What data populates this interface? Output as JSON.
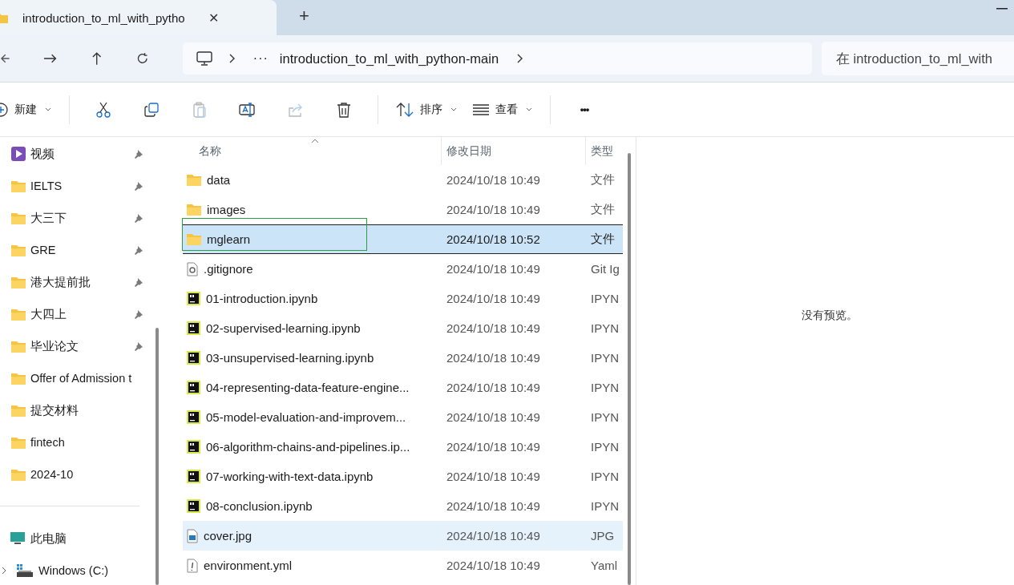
{
  "tab": {
    "title": "introduction_to_ml_with_pytho",
    "close": "✕",
    "new": "+"
  },
  "address": {
    "ellipsis": "···",
    "path": "introduction_to_ml_with_python-main"
  },
  "search": {
    "placeholder": "在 introduction_to_ml_with"
  },
  "toolbar": [
    {
      "kind": "new",
      "label": "新建",
      "disabled": false
    },
    {
      "kind": "cut",
      "disabled": false
    },
    {
      "kind": "copy",
      "disabled": false
    },
    {
      "kind": "paste",
      "disabled": true
    },
    {
      "kind": "rename",
      "disabled": false
    },
    {
      "kind": "share",
      "disabled": true
    },
    {
      "kind": "delete",
      "disabled": false
    },
    {
      "kind": "sort",
      "label": "排序",
      "disabled": false
    },
    {
      "kind": "view",
      "label": "查看",
      "disabled": false
    },
    {
      "kind": "more",
      "label": "•••",
      "disabled": false
    }
  ],
  "sidebar": {
    "quick": [
      {
        "kind": "video",
        "label": "视频",
        "pinned": true
      },
      {
        "kind": "folder",
        "label": "IELTS",
        "pinned": true
      },
      {
        "kind": "folder",
        "label": "大三下",
        "pinned": true
      },
      {
        "kind": "folder",
        "label": "GRE",
        "pinned": true
      },
      {
        "kind": "folder",
        "label": "港大提前批",
        "pinned": true
      },
      {
        "kind": "folder",
        "label": "大四上",
        "pinned": true
      },
      {
        "kind": "folder",
        "label": "毕业论文",
        "pinned": true
      },
      {
        "kind": "folder",
        "label": "Offer of Admission t",
        "pinned": false
      },
      {
        "kind": "folder",
        "label": "提交材料",
        "pinned": false
      },
      {
        "kind": "folder",
        "label": "fintech",
        "pinned": false
      },
      {
        "kind": "folder",
        "label": "2024-10",
        "pinned": false
      }
    ],
    "devices": [
      {
        "kind": "pc",
        "label": "此电脑"
      },
      {
        "kind": "drive",
        "label": "Windows (C:)",
        "expanded": false
      }
    ]
  },
  "table": {
    "columns": [
      "名称",
      "修改日期",
      "类型"
    ],
    "rows": [
      {
        "kind": "folder",
        "name": "data",
        "date": "2024/10/18 10:49",
        "type": "文件",
        "selected": false,
        "hovered": false,
        "outlined": false
      },
      {
        "kind": "folder",
        "name": "images",
        "date": "2024/10/18 10:49",
        "type": "文件",
        "selected": false,
        "hovered": false,
        "outlined": false
      },
      {
        "kind": "folder",
        "name": "mglearn",
        "date": "2024/10/18 10:52",
        "type": "文件",
        "selected": true,
        "hovered": false,
        "outlined": true
      },
      {
        "kind": "config",
        "name": ".gitignore",
        "date": "2024/10/18 10:49",
        "type": "Git Ig",
        "selected": false,
        "hovered": false,
        "outlined": false
      },
      {
        "kind": "notebook",
        "name": "01-introduction.ipynb",
        "date": "2024/10/18 10:49",
        "type": "IPYN",
        "selected": false,
        "hovered": false,
        "outlined": false
      },
      {
        "kind": "notebook",
        "name": "02-supervised-learning.ipynb",
        "date": "2024/10/18 10:49",
        "type": "IPYN",
        "selected": false,
        "hovered": false,
        "outlined": false
      },
      {
        "kind": "notebook",
        "name": "03-unsupervised-learning.ipynb",
        "date": "2024/10/18 10:49",
        "type": "IPYN",
        "selected": false,
        "hovered": false,
        "outlined": false
      },
      {
        "kind": "notebook",
        "name": "04-representing-data-feature-engine...",
        "date": "2024/10/18 10:49",
        "type": "IPYN",
        "selected": false,
        "hovered": false,
        "outlined": false
      },
      {
        "kind": "notebook",
        "name": "05-model-evaluation-and-improvem...",
        "date": "2024/10/18 10:49",
        "type": "IPYN",
        "selected": false,
        "hovered": false,
        "outlined": false
      },
      {
        "kind": "notebook",
        "name": "06-algorithm-chains-and-pipelines.ip...",
        "date": "2024/10/18 10:49",
        "type": "IPYN",
        "selected": false,
        "hovered": false,
        "outlined": false
      },
      {
        "kind": "notebook",
        "name": "07-working-with-text-data.ipynb",
        "date": "2024/10/18 10:49",
        "type": "IPYN",
        "selected": false,
        "hovered": false,
        "outlined": false
      },
      {
        "kind": "notebook",
        "name": "08-conclusion.ipynb",
        "date": "2024/10/18 10:49",
        "type": "IPYN",
        "selected": false,
        "hovered": false,
        "outlined": false
      },
      {
        "kind": "image",
        "name": "cover.jpg",
        "date": "2024/10/18 10:49",
        "type": "JPG",
        "selected": false,
        "hovered": true,
        "outlined": false
      },
      {
        "kind": "text",
        "name": "environment.yml",
        "date": "2024/10/18 10:49",
        "type": "Yaml",
        "selected": false,
        "hovered": false,
        "outlined": false
      }
    ]
  },
  "preview": {
    "message": "没有预览。"
  }
}
